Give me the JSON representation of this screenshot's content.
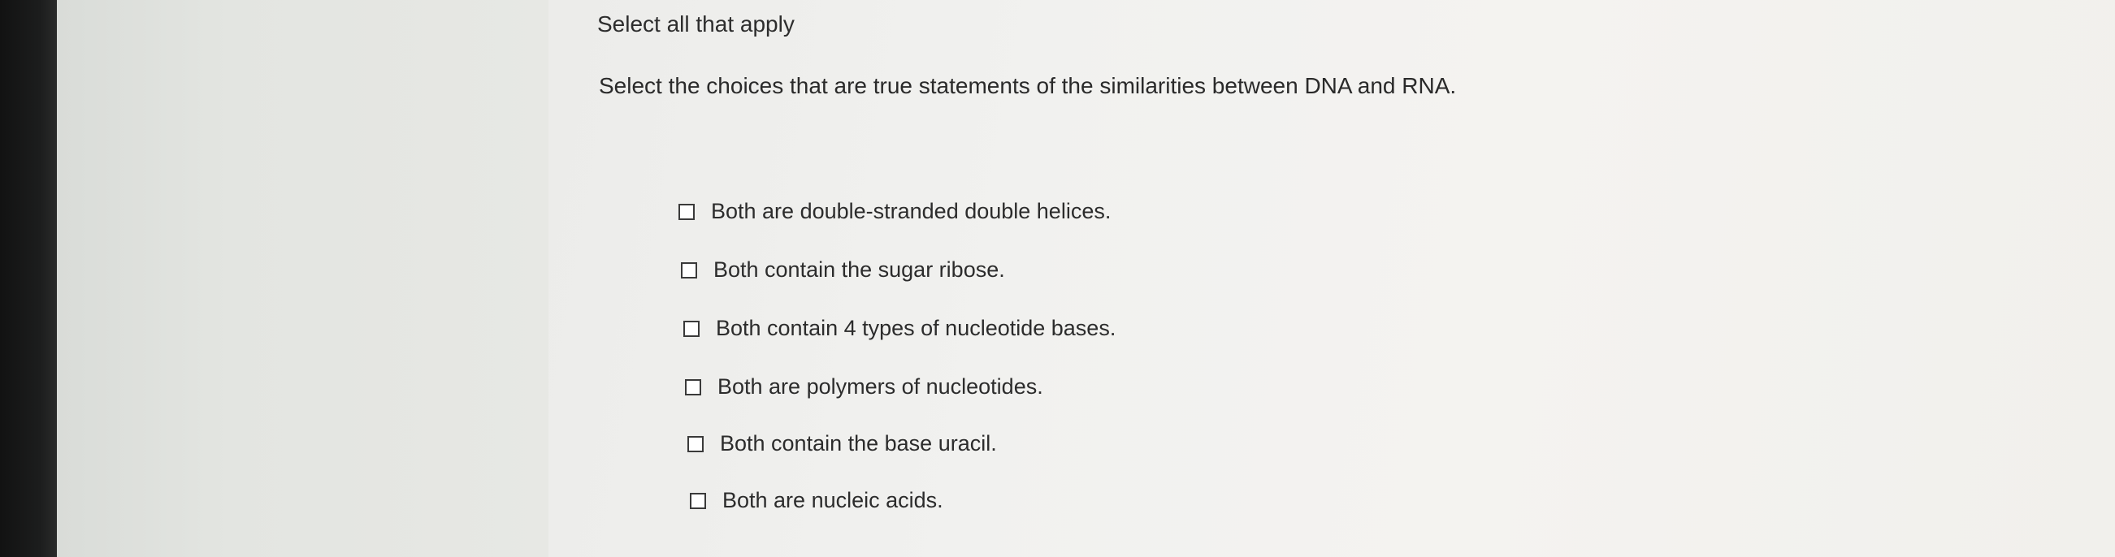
{
  "question": {
    "instruction": "Select all that apply",
    "prompt": "Select the choices that are true statements of the similarities between DNA and RNA.",
    "choices": [
      {
        "label": "Both are double-stranded double helices.",
        "checked": false
      },
      {
        "label": "Both contain the sugar ribose.",
        "checked": false
      },
      {
        "label": "Both contain 4 types of nucleotide bases.",
        "checked": false
      },
      {
        "label": "Both are polymers of nucleotides.",
        "checked": false
      },
      {
        "label": "Both contain the base uracil.",
        "checked": false
      },
      {
        "label": "Both are nucleic acids.",
        "checked": false
      }
    ]
  }
}
